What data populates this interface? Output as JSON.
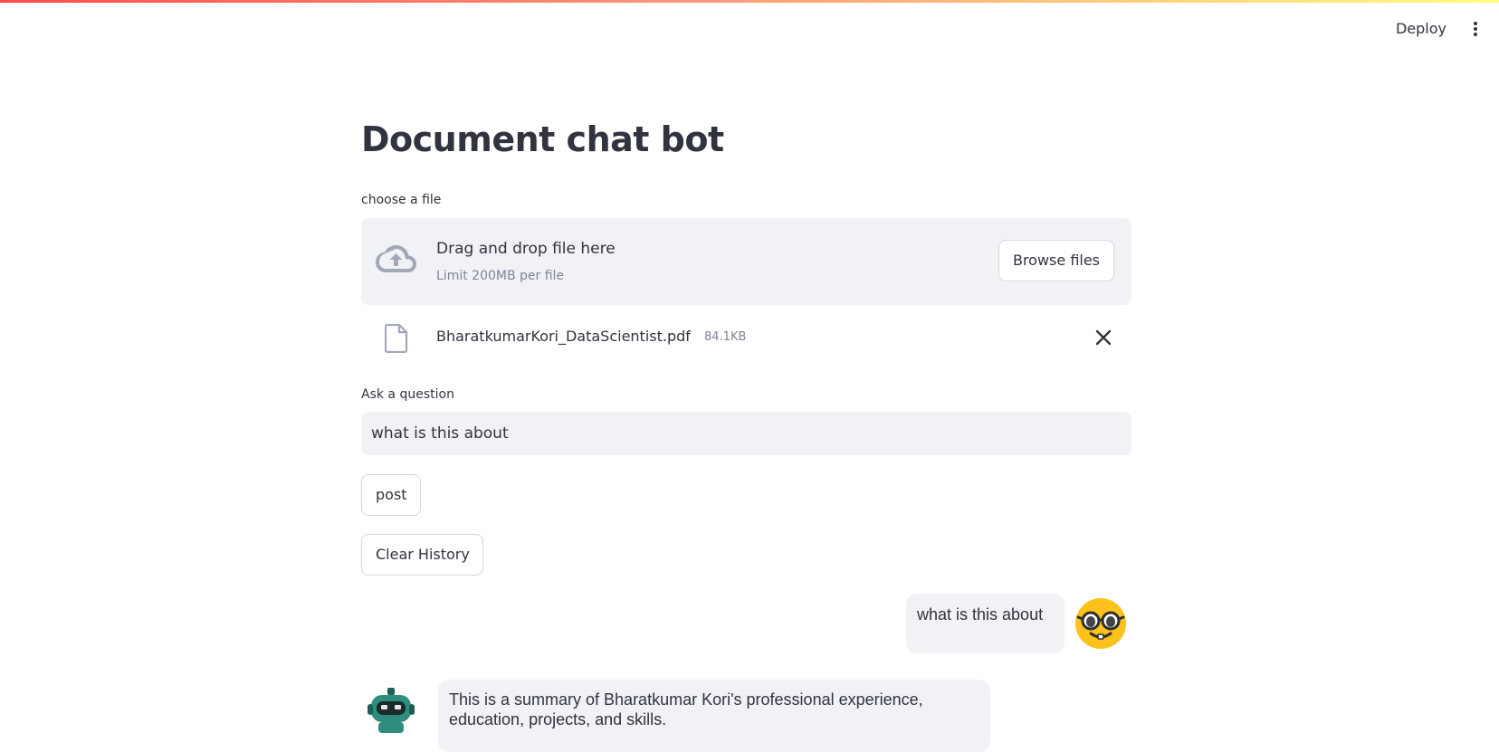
{
  "header": {
    "deploy_label": "Deploy",
    "menu_icon": "vertical-ellipsis-icon"
  },
  "page": {
    "title": "Document chat bot"
  },
  "uploader": {
    "label": "choose a file",
    "drop_text": "Drag and drop file here",
    "limit_text": "Limit 200MB per file",
    "browse_label": "Browse files",
    "icon": "cloud-upload-icon",
    "file": {
      "name": "BharatkumarKori_DataScientist.pdf",
      "size": "84.1KB",
      "icon": "file-icon",
      "remove_icon": "close-icon"
    }
  },
  "question": {
    "label": "Ask a question",
    "value": "what is this about"
  },
  "buttons": {
    "post_label": "post",
    "clear_label": "Clear History"
  },
  "chat": {
    "messages": [
      {
        "role": "user",
        "text": "what is this about",
        "avatar": "nerd-face-emoji-icon"
      },
      {
        "role": "bot",
        "text": "This is a summary of Bharatkumar Kori's professional experience, education, projects, and skills.",
        "avatar": "robot-avatar-icon"
      }
    ]
  },
  "colors": {
    "accent_gradient_start": "#ff4b4b",
    "accent_gradient_end": "#fffd80",
    "surface": "#f0f2f6",
    "text": "#31333f",
    "muted_text": "#808495"
  }
}
